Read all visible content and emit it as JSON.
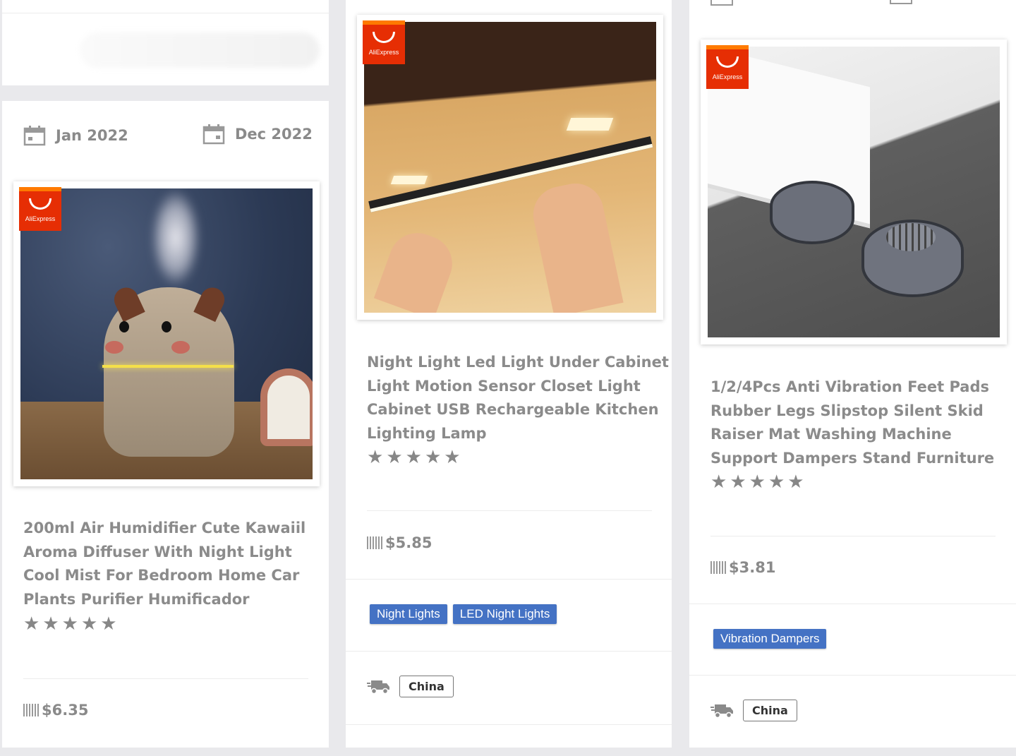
{
  "cards": [
    {
      "start_date": "Jan 2022",
      "end_date": "Dec 2022",
      "store_badge": "AliExpress",
      "title_lines": [
        "200ml Air Humidifier Cute Kawaiil",
        "Aroma Diffuser With Night Light",
        "Cool Mist For Bedroom Home Car",
        "Plants Purifier Humificador"
      ],
      "rating": 5,
      "price": "$6.35"
    },
    {
      "store_badge": "AliExpress",
      "title_lines": [
        "Night Light Led Light Under Cabinet",
        "Light Motion Sensor Closet Light",
        "Cabinet USB Rechargeable Kitchen",
        "Lighting Lamp"
      ],
      "rating": 5,
      "price": "$5.85",
      "tags": [
        "Night Lights",
        "LED Night Lights"
      ],
      "ships_from": "China"
    },
    {
      "store_badge": "AliExpress",
      "title_lines": [
        "1/2/4Pcs Anti Vibration Feet Pads",
        "Rubber Legs Slipstop Silent Skid",
        "Raiser Mat Washing Machine",
        "Support Dampers Stand Furniture"
      ],
      "rating": 5,
      "price": "$3.81",
      "tags": [
        "Vibration Dampers"
      ],
      "ships_from": "China"
    }
  ],
  "colors": {
    "tag_bg": "#4472c4",
    "badge_red": "#e62e04",
    "badge_orange": "#ff7a00",
    "text_gray": "#8b8b8b"
  },
  "icons": [
    "calendar-icon",
    "star-icon",
    "barcode-icon",
    "truck-icon",
    "aliexpress-logo"
  ]
}
